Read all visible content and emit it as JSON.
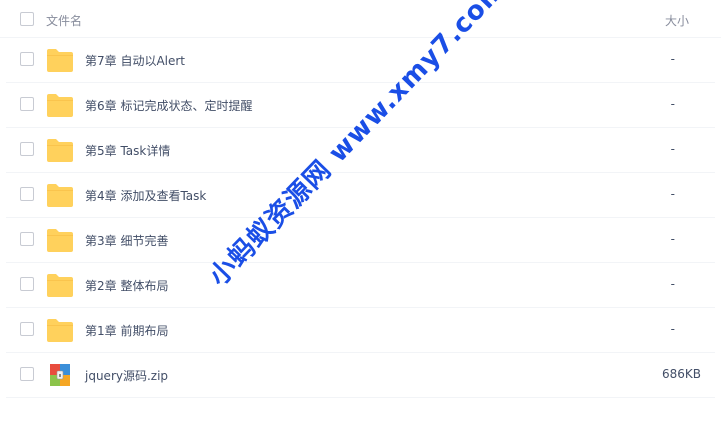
{
  "header": {
    "name_label": "文件名",
    "size_label": "大小"
  },
  "files": [
    {
      "name": "第7章 自动以Alert",
      "size": "-",
      "type": "folder"
    },
    {
      "name": "第6章 标记完成状态、定时提醒",
      "size": "-",
      "type": "folder"
    },
    {
      "name": "第5章 Task详情",
      "size": "-",
      "type": "folder"
    },
    {
      "name": "第4章 添加及查看Task",
      "size": "-",
      "type": "folder"
    },
    {
      "name": "第3章 细节完善",
      "size": "-",
      "type": "folder"
    },
    {
      "name": "第2章 整体布局",
      "size": "-",
      "type": "folder"
    },
    {
      "name": "第1章 前期布局",
      "size": "-",
      "type": "folder"
    },
    {
      "name": "jquery源码.zip",
      "size": "686KB",
      "type": "zip"
    }
  ],
  "watermark": "小蚂蚁资源网 www.xmy7.com",
  "colors": {
    "folder": "#ffd15c",
    "folder_dark": "#f5b83d",
    "watermark": "#1a4ee6"
  }
}
